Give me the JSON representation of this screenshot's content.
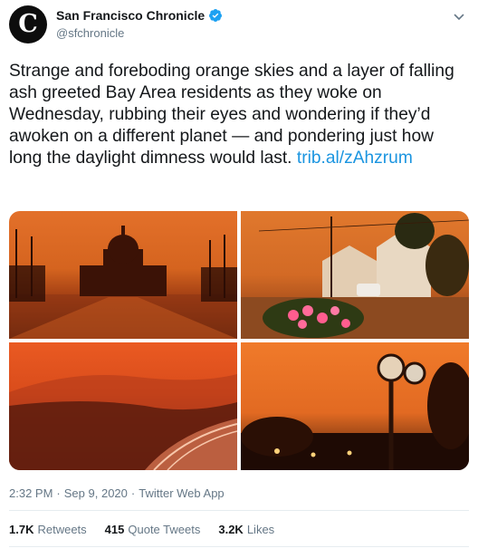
{
  "tweet": {
    "author": {
      "display_name": "San Francisco Chronicle",
      "handle": "@sfchronicle",
      "avatar_letter": "C",
      "verified": true
    },
    "text": "Strange and foreboding orange skies and a layer of falling ash greeted Bay Area residents as they woke on Wednesday, rubbing their eyes and wondering if they’d awoken on a different planet — and pondering just how long the daylight dimness would last.",
    "link_text": "trib.al/zAhzrum",
    "media": {
      "photos": [
        {
          "subject": "city-hall-orange-sky"
        },
        {
          "subject": "street-with-houses-and-flowers"
        },
        {
          "subject": "coastline-aerial-orange-haze"
        },
        {
          "subject": "street-clock-dusk"
        }
      ]
    },
    "meta": {
      "time": "2:32 PM",
      "sep1": "·",
      "date": "Sep 9, 2020",
      "sep2": "·",
      "source": "Twitter Web App"
    },
    "stats": {
      "retweets_count": "1.7K",
      "retweets_label": "Retweets",
      "quotes_count": "415",
      "quotes_label": "Quote Tweets",
      "likes_count": "3.2K",
      "likes_label": "Likes"
    }
  },
  "colors": {
    "text_primary": "#14171a",
    "text_secondary": "#657786",
    "link": "#1b95e0",
    "verified_badge": "#1da1f2",
    "divider": "#e6ecf0"
  },
  "icons": [
    "newspaper-logo-icon",
    "verified-badge-icon",
    "chevron-down-icon"
  ]
}
